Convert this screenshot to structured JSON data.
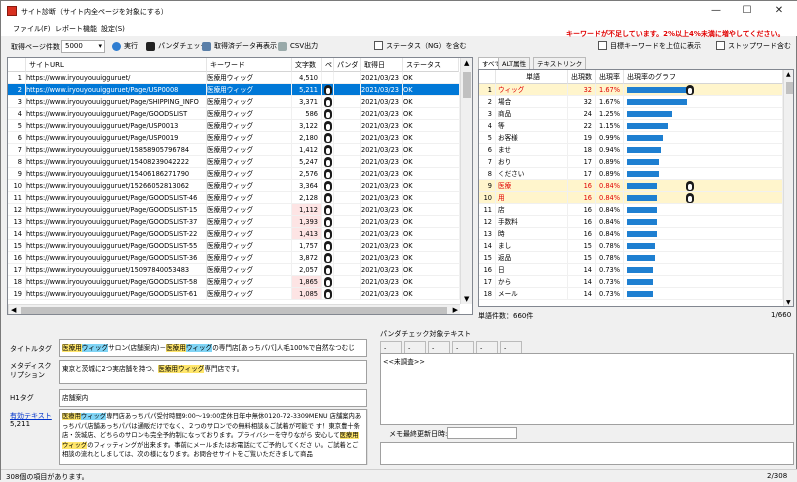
{
  "window": {
    "title": "サイト診断（サイト内全ページを対象にする）",
    "minimize": "—",
    "maximize": "☐",
    "close": "✕"
  },
  "menu": [
    "ファイル(F)",
    "レポート機能",
    "設定(S)"
  ],
  "toolbar": {
    "pages_label": "取得ページ件数",
    "pages_value": "5000",
    "run": "実行",
    "panda_check": "パンダチェック",
    "show_data": "取得済データ再表示",
    "csv": "CSV出力",
    "status_ng": "ステータス（NG）を含む",
    "warn1": "キーワードが不足しています。2%以上4%未満に増やしてください。",
    "top_kw": "目標キーワードを上位に表示",
    "stopword": "ストップワード含む"
  },
  "table": {
    "headers": [
      "",
      "サイトURL",
      "キーワード",
      "文字数",
      "ペ",
      "パンダ",
      "取得日",
      "ステータス"
    ],
    "rows": [
      {
        "n": "1",
        "url": "https://www.iryouyouuigguruet/",
        "kw": "医療用ウィッグ",
        "chars": "4,510",
        "p": false,
        "date": "2021/03/23",
        "st": "OK"
      },
      {
        "n": "2",
        "url": "https://www.iryouyouuigguruet/Page/USP0008",
        "kw": "医療用ウィッグ",
        "chars": "5,211",
        "p": true,
        "date": "2021/03/23",
        "st": "OK"
      },
      {
        "n": "3",
        "url": "https://www.iryouyouuigguruet/Page/SHIPPING_INFO",
        "kw": "医療用ウィッグ",
        "chars": "3,371",
        "p": true,
        "date": "2021/03/23",
        "st": "OK"
      },
      {
        "n": "4",
        "url": "https://www.iryouyouuigguruet/Page/GOODSLIST",
        "kw": "医療用ウィッグ",
        "chars": "586",
        "p": true,
        "date": "2021/03/23",
        "st": "OK"
      },
      {
        "n": "5",
        "url": "https://www.iryouyouuigguruet/Page/USP0013",
        "kw": "医療用ウィッグ",
        "chars": "3,122",
        "p": true,
        "date": "2021/03/23",
        "st": "OK"
      },
      {
        "n": "6",
        "url": "https://www.iryouyouuigguruet/Page/USP0019",
        "kw": "医療用ウィッグ",
        "chars": "2,180",
        "p": true,
        "date": "2021/03/23",
        "st": "OK"
      },
      {
        "n": "7",
        "url": "https://www.iryouyouuigguruet/15858905796784",
        "kw": "医療用ウィッグ",
        "chars": "1,412",
        "p": true,
        "date": "2021/03/23",
        "st": "OK"
      },
      {
        "n": "8",
        "url": "https://www.iryouyouuigguruet/15408239042222",
        "kw": "医療用ウィッグ",
        "chars": "5,247",
        "p": true,
        "date": "2021/03/23",
        "st": "OK"
      },
      {
        "n": "9",
        "url": "https://www.iryouyouuigguruet/15406186271790",
        "kw": "医療用ウィッグ",
        "chars": "2,576",
        "p": true,
        "date": "2021/03/23",
        "st": "OK"
      },
      {
        "n": "10",
        "url": "https://www.iryouyouuigguruet/15266052813062",
        "kw": "医療用ウィッグ",
        "chars": "3,364",
        "p": true,
        "date": "2021/03/23",
        "st": "OK"
      },
      {
        "n": "11",
        "url": "https://www.iryouyouuigguruet/Page/GOODSLIST-46",
        "kw": "医療用ウィッグ",
        "chars": "2,128",
        "p": true,
        "date": "2021/03/23",
        "st": "OK"
      },
      {
        "n": "12",
        "url": "https://www.iryouyouuigguruet/Page/GOODSLIST-15",
        "kw": "医療用ウィッグ",
        "chars": "1,112",
        "p": true,
        "date": "2021/03/23",
        "st": "OK"
      },
      {
        "n": "13",
        "url": "https://www.iryouyouuigguruet/Page/GOODSLIST-37",
        "kw": "医療用ウィッグ",
        "chars": "1,393",
        "p": true,
        "date": "2021/03/23",
        "st": "OK"
      },
      {
        "n": "14",
        "url": "https://www.iryouyouuigguruet/Page/GOODSLIST-22",
        "kw": "医療用ウィッグ",
        "chars": "1,413",
        "p": true,
        "date": "2021/03/23",
        "st": "OK"
      },
      {
        "n": "15",
        "url": "https://www.iryouyouuigguruet/Page/GOODSLIST-55",
        "kw": "医療用ウィッグ",
        "chars": "1,757",
        "p": true,
        "date": "2021/03/23",
        "st": "OK"
      },
      {
        "n": "16",
        "url": "https://www.iryouyouuigguruet/Page/GOODSLIST-36",
        "kw": "医療用ウィッグ",
        "chars": "3,872",
        "p": true,
        "date": "2021/03/23",
        "st": "OK"
      },
      {
        "n": "17",
        "url": "https://www.iryouyouuigguruet/15097840053483",
        "kw": "医療用ウィッグ",
        "chars": "2,057",
        "p": true,
        "date": "2021/03/23",
        "st": "OK"
      },
      {
        "n": "18",
        "url": "https://www.iryouyouuigguruet/Page/GOODSLIST-58",
        "kw": "医療用ウィッグ",
        "chars": "1,865",
        "p": true,
        "date": "2021/03/23",
        "st": "OK"
      },
      {
        "n": "19",
        "url": "https://www.iryouyouuigguruet/Page/GOODSLIST-61",
        "kw": "医療用ウィッグ",
        "chars": "1,085",
        "p": true,
        "date": "2021/03/23",
        "st": "OK"
      }
    ],
    "pink_rows": [
      "12",
      "13",
      "14",
      "18",
      "19"
    ]
  },
  "tabs": [
    "すべて",
    "ALT属性",
    "テキストリンク"
  ],
  "words": {
    "headers": [
      "単語",
      "出現数",
      "出現率",
      "出現率のグラフ"
    ],
    "rows": [
      {
        "n": "1",
        "w": "ウィッグ",
        "c": "32",
        "r": "1.67%",
        "pct": 1.67,
        "p": true,
        "hl": true
      },
      {
        "n": "2",
        "w": "場合",
        "c": "32",
        "r": "1.67%",
        "pct": 1.67,
        "p": false,
        "hl": false
      },
      {
        "n": "3",
        "w": "商品",
        "c": "24",
        "r": "1.25%",
        "pct": 1.25,
        "p": false,
        "hl": false
      },
      {
        "n": "4",
        "w": "等",
        "c": "22",
        "r": "1.15%",
        "pct": 1.15,
        "p": false,
        "hl": false
      },
      {
        "n": "5",
        "w": "お客様",
        "c": "19",
        "r": "0.99%",
        "pct": 0.99,
        "p": false,
        "hl": false
      },
      {
        "n": "6",
        "w": "ませ",
        "c": "18",
        "r": "0.94%",
        "pct": 0.94,
        "p": false,
        "hl": false
      },
      {
        "n": "7",
        "w": "おり",
        "c": "17",
        "r": "0.89%",
        "pct": 0.89,
        "p": false,
        "hl": false
      },
      {
        "n": "8",
        "w": "ください",
        "c": "17",
        "r": "0.89%",
        "pct": 0.89,
        "p": false,
        "hl": false
      },
      {
        "n": "9",
        "w": "医療",
        "c": "16",
        "r": "0.84%",
        "pct": 0.84,
        "p": true,
        "hl": true
      },
      {
        "n": "10",
        "w": "用",
        "c": "16",
        "r": "0.84%",
        "pct": 0.84,
        "p": true,
        "hl": true
      },
      {
        "n": "11",
        "w": "店",
        "c": "16",
        "r": "0.84%",
        "pct": 0.84,
        "p": false,
        "hl": false
      },
      {
        "n": "12",
        "w": "手数料",
        "c": "16",
        "r": "0.84%",
        "pct": 0.84,
        "p": false,
        "hl": false
      },
      {
        "n": "13",
        "w": "時",
        "c": "16",
        "r": "0.84%",
        "pct": 0.84,
        "p": false,
        "hl": false
      },
      {
        "n": "14",
        "w": "まし",
        "c": "15",
        "r": "0.78%",
        "pct": 0.78,
        "p": false,
        "hl": false
      },
      {
        "n": "15",
        "w": "返品",
        "c": "15",
        "r": "0.78%",
        "pct": 0.78,
        "p": false,
        "hl": false
      },
      {
        "n": "16",
        "w": "日",
        "c": "14",
        "r": "0.73%",
        "pct": 0.73,
        "p": false,
        "hl": false
      },
      {
        "n": "17",
        "w": "から",
        "c": "14",
        "r": "0.73%",
        "pct": 0.73,
        "p": false,
        "hl": false
      },
      {
        "n": "18",
        "w": "メール",
        "c": "14",
        "r": "0.73%",
        "pct": 0.73,
        "p": false,
        "hl": false
      }
    ],
    "count_label": "単語件数：660件",
    "pager": "1/660"
  },
  "details": {
    "title_label": "タイトルタグ",
    "title_pre": "",
    "title_h1": "医療用",
    "title_h2": "ウィッグ",
    "title_mid": "サロン(店舗案内)－",
    "title_h3": "医療用",
    "title_h4": "ウィッグ",
    "title_post": "の専門店[あっちパパ]人毛100%で自然なつむじ",
    "meta_label": "メタディスクリプション",
    "meta_pre": "東京と茨城に2つ実店舗を持つ、",
    "meta_h": "医療用ウィッグ",
    "meta_post": "専門店です。",
    "h1_label": "H1タグ",
    "h1_value": "店舗案内",
    "text_label": "有効テキスト",
    "text_count": "5,211",
    "text_h1": "医療用",
    "text_h2": "ウィッグ",
    "text_body1": "専門店あっちパパ受付時間9:00～19:00定休日年中無休0120-72-3309MENU 店舗案内あっちパパ店舗あっちパパは通販だけでなく、２つのサロンでの無料相談＆ご試着が可能で す！東京豊十条店・茨城店、どちらのサロンも完全予約制になっております。プライバシーを守りながら 安心して",
    "text_h3": "医療用ウィッグ",
    "text_body2": "のフィッティングが出来ます。事前にメールまたはお電話にてご予約してくださ い。ご試着とご相談の流れとしましては、次の様になります。お問合せサイトをご覧いただきまして商品",
    "panda_label": "パンダチェック対象テキスト",
    "panda_tabs": [
      "-",
      "-",
      "-",
      "-",
      "-",
      "-"
    ],
    "panda_status": "<<未調査>>",
    "memo_label": "メモ最終更新日時:"
  },
  "status": {
    "left": "308個の項目があります。",
    "right": "2/308"
  }
}
